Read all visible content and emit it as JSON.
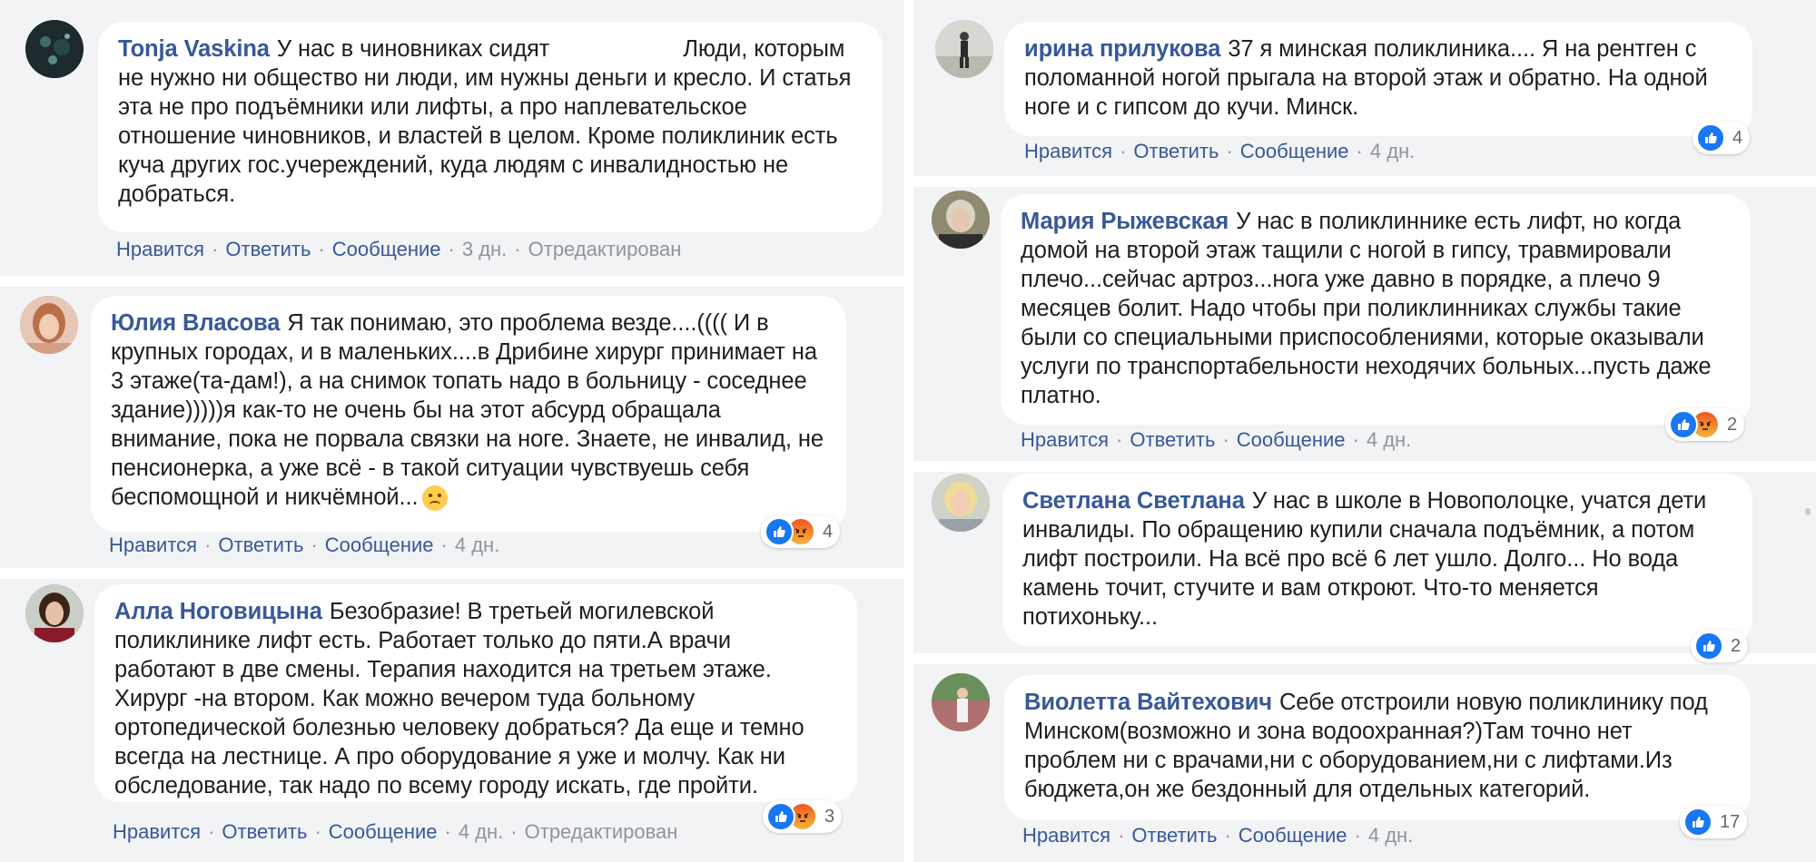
{
  "actions": {
    "like": "Нравится",
    "reply": "Ответить",
    "message": "Сообщение",
    "edited": "Отредактирован",
    "dot": "·"
  },
  "comments": [
    {
      "author": "Tonja Vaskina",
      "text_before": "У нас в чиновниках сидят",
      "text": "Люди, которым не нужно ни общество ни люди, им нужны деньги и кресло. И статья эта не про подъёмники или лифты, а про наплевательское отношение чиновников, и властей в целом. Кроме поликлиник есть куча других гос.учереждений, куда людям с инвалидностью не добраться.",
      "time": "3 дн.",
      "edited": true
    },
    {
      "author": "Юлия Власова",
      "text": "Я так понимаю, это проблема везде....(((( И в крупных городах, и в маленьких....в Дрибине хирург принимает на 3 этаже(та-дам!), а на снимок топать надо в больницу - соседнее здание)))))я как-то не очень бы на этот абсурд обращала внимание, пока не порвала связки на ноге. Знаете, не инвалид, не пенсионерка, а уже всё - в такой ситуации чувствуешь себя беспомощной и никчёмной...",
      "time": "4 дн.",
      "reactions": [
        "like",
        "angry"
      ],
      "reaction_count": "4"
    },
    {
      "author": "Алла Ноговицына",
      "text": "Безобразие! В третьей могилевской поликлинике лифт есть. Работает только до пяти.А врачи работают в две смены. Терапия находится на третьем этаже. Хирург -на втором. Как можно вечером туда больному ортопедической болезнью человеку добраться? Да еще и темно всегда на лестнице. А про оборудование я уже и молчу. Как ни обследование, так надо по всему городу искать, где пройти.",
      "time": "4 дн.",
      "edited": true,
      "reactions": [
        "like",
        "angry"
      ],
      "reaction_count": "3"
    },
    {
      "author": "ирина прилукова",
      "text": "37 я минская поликлиника.... Я на рентген с поломанной ногой прыгала на второй этаж и обратно. На одной ноге и с гипсом до кучи. Минск.",
      "time": "4 дн.",
      "reactions": [
        "like"
      ],
      "reaction_count": "4"
    },
    {
      "author": "Мария Рыжевская",
      "text": "У нас в поликлиннике есть лифт, но когда домой на второй этаж тащили с ногой в гипсу, травмировали плечо...сейчас артроз...нога уже давно в порядке, а плечо 9 месяцев болит. Надо чтобы при поликлинниках службы такие были со специальными приспособлениями, которые оказывали услуги по транспортабельности неходячих больных...пусть даже платно.",
      "time": "4 дн.",
      "reactions": [
        "like",
        "angry"
      ],
      "reaction_count": "2"
    },
    {
      "author": "Светлана Светлана",
      "text": "У нас в школе в Новополоцке, учатся дети инвалиды. По обращению купили сначала подъёмник, а потом лифт построили. На всё про всё 6 лет ушло. Долго... Но вода камень точит, стучите и вам откроют. Что-то меняется потихоньку...",
      "reactions": [
        "like"
      ],
      "reaction_count": "2"
    },
    {
      "author": "Виолетта Вайтехович",
      "text": "Себе отстроили новую поликлинику под Минском(возможно и зона водоохранная?)Там точно нет проблем ни с врачами,ни с оборудованием,ни с лифтами.Из бюджета,он же бездонный для отдельных категорий.",
      "time": "4 дн.",
      "reactions": [
        "like"
      ],
      "reaction_count": "17"
    }
  ],
  "colors": {
    "author": "#385898",
    "like": "#1877f2",
    "angry": "#f0571f",
    "meta": "#90949c"
  }
}
